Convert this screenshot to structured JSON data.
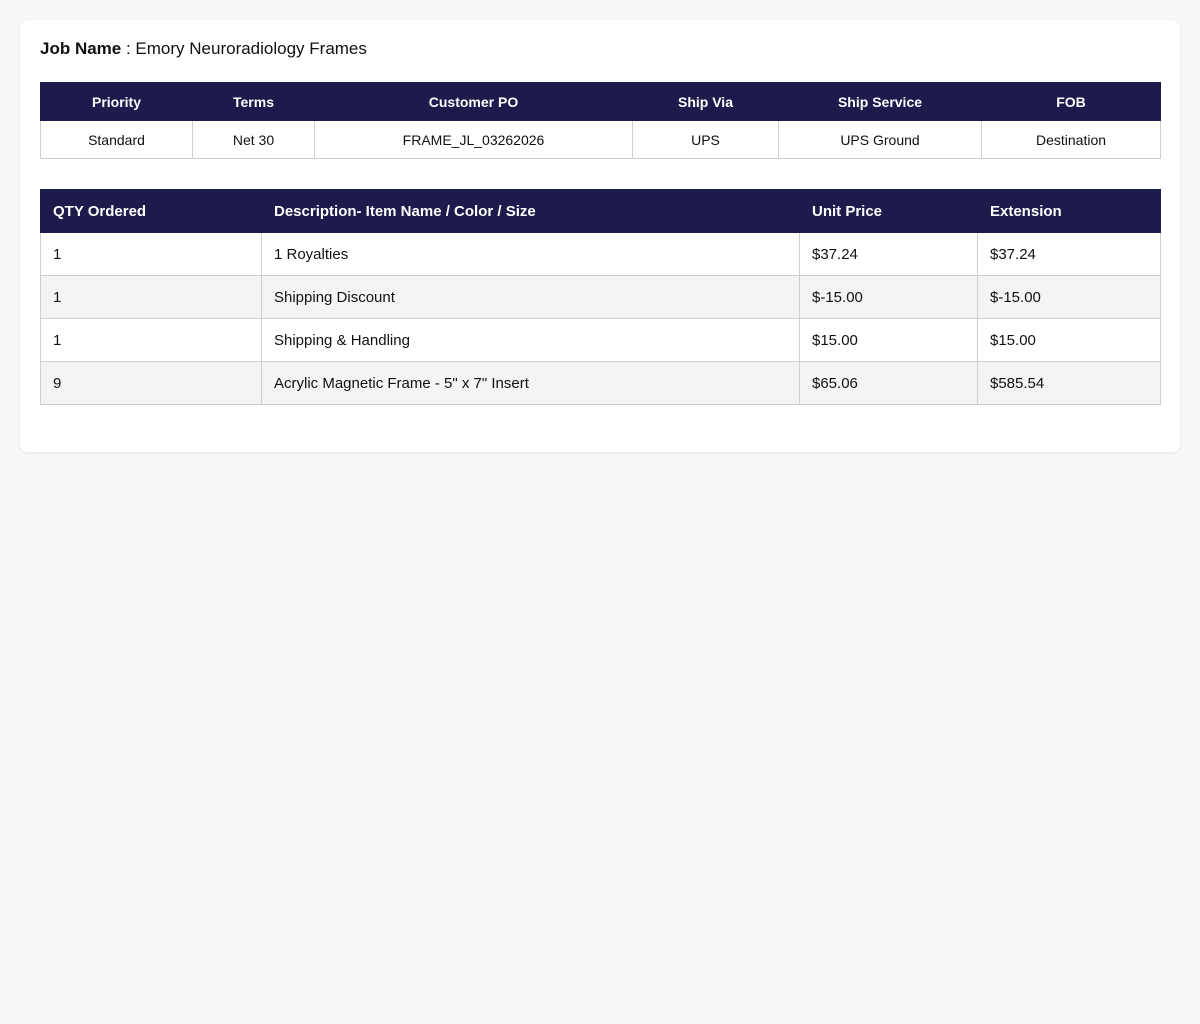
{
  "job": {
    "label": "Job Name",
    "separator": " : ",
    "value": "Emory Neuroradiology Frames"
  },
  "order_info": {
    "headers": [
      "Priority",
      "Terms",
      "Customer PO",
      "Ship Via",
      "Ship Service",
      "FOB"
    ],
    "values": [
      "Standard",
      "Net 30",
      "FRAME_JL_03262026",
      "UPS",
      "UPS Ground",
      "Destination"
    ]
  },
  "items": {
    "headers": [
      "QTY Ordered",
      "Description- Item Name / Color / Size",
      "Unit Price",
      "Extension"
    ],
    "rows": [
      [
        "1",
        "1 Royalties",
        "$37.24",
        "$37.24"
      ],
      [
        "1",
        "Shipping Discount",
        "$-15.00",
        "$-15.00"
      ],
      [
        "1",
        "Shipping & Handling",
        "$15.00",
        "$15.00"
      ],
      [
        "9",
        "Acrylic Magnetic Frame - 5\" x 7\" Insert",
        "$65.06",
        "$585.54"
      ]
    ]
  },
  "colors": {
    "header_bg": "#1c1b4b",
    "page_bg": "#f8f8f8"
  }
}
